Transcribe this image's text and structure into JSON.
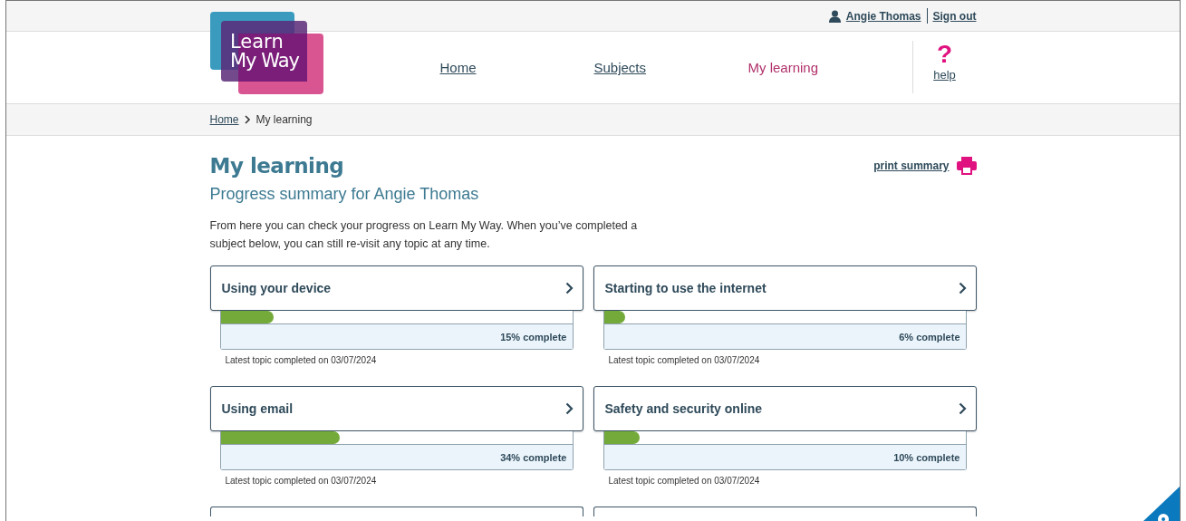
{
  "top_bar": {
    "user": "Angie Thomas",
    "sign_out": "Sign out"
  },
  "logo": {
    "line_1": "Learn",
    "line_2": "My Way"
  },
  "nav": [
    {
      "label": "Home",
      "selected": false
    },
    {
      "label": "Subjects",
      "selected": false
    },
    {
      "label": "My learning",
      "selected": true
    }
  ],
  "help": {
    "icon": "?",
    "label": "help"
  },
  "breadcrumb": {
    "link": "Home",
    "current": "My learning"
  },
  "page": {
    "title": "My learning",
    "print": "print summary",
    "subtitle": "Progress summary for Angie Thomas",
    "intro": "From here you can check your progress on Learn My Way. When you’ve completed a subject below, you can still re-visit any topic at any time."
  },
  "subjects": [
    {
      "title": "Using your device",
      "level": 0.15,
      "reading": "15% complete",
      "latest": "Latest topic completed on 03/07/2024"
    },
    {
      "title": "Starting to use the internet",
      "level": 0.06,
      "reading": "6% complete",
      "latest": "Latest topic completed on 03/07/2024"
    },
    {
      "title": "Using email",
      "level": 0.34,
      "reading": "34% complete",
      "latest": "Latest topic completed on 03/07/2024"
    },
    {
      "title": "Safety and security online",
      "level": 0.1,
      "reading": "10% complete",
      "latest": "Latest topic completed on 03/07/2024"
    }
  ]
}
